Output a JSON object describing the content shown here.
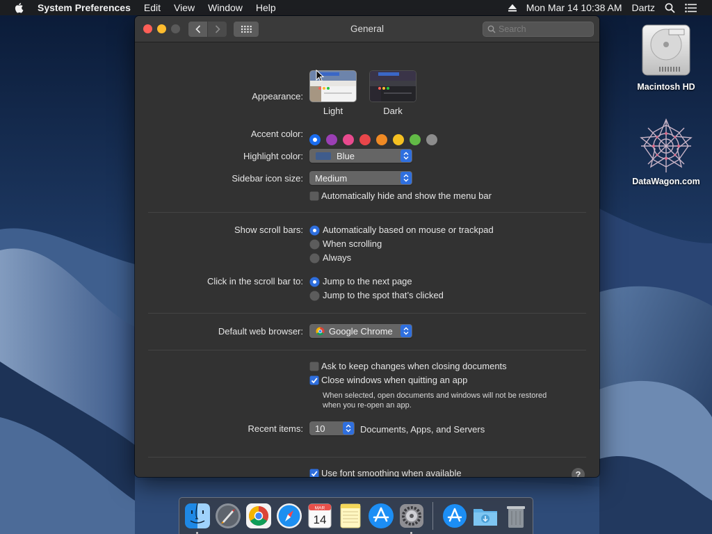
{
  "menubar": {
    "app_name": "System Preferences",
    "menus": [
      "Edit",
      "View",
      "Window",
      "Help"
    ],
    "datetime": "Mon Mar 14  10:38 AM",
    "user": "Dartz"
  },
  "desktop": {
    "icons": [
      {
        "label": "Macintosh HD"
      },
      {
        "label": "DataWagon.com"
      }
    ]
  },
  "window": {
    "title": "General",
    "search_placeholder": "Search"
  },
  "appearance": {
    "label": "Appearance:",
    "options": [
      {
        "label": "Light",
        "selected": true
      },
      {
        "label": "Dark",
        "selected": false
      }
    ]
  },
  "accent": {
    "label": "Accent color:",
    "colors": [
      "#1a6df0",
      "#9b3fb5",
      "#e84a8e",
      "#e8464a",
      "#f08a24",
      "#f5c021",
      "#62ba46",
      "#8c8c8c"
    ],
    "selected_index": 0
  },
  "highlight": {
    "label": "Highlight color:",
    "value": "Blue",
    "chip_color": "#3f5c8c"
  },
  "sidebar_icon_size": {
    "label": "Sidebar icon size:",
    "value": "Medium"
  },
  "auto_hide_menubar": {
    "label": "Automatically hide and show the menu bar",
    "checked": false
  },
  "scroll_bars": {
    "label": "Show scroll bars:",
    "options": [
      {
        "label": "Automatically based on mouse or trackpad",
        "selected": true
      },
      {
        "label": "When scrolling",
        "selected": false
      },
      {
        "label": "Always",
        "selected": false
      }
    ]
  },
  "scroll_click": {
    "label": "Click in the scroll bar to:",
    "options": [
      {
        "label": "Jump to the next page",
        "selected": true
      },
      {
        "label": "Jump to the spot that’s clicked",
        "selected": false
      }
    ]
  },
  "browser": {
    "label": "Default web browser:",
    "value": "Google Chrome"
  },
  "ask_keep_changes": {
    "label": "Ask to keep changes when closing documents",
    "checked": false
  },
  "close_windows": {
    "label": "Close windows when quitting an app",
    "checked": true,
    "note_line1": "When selected, open documents and windows will not be restored",
    "note_line2": "when you re-open an app."
  },
  "recent_items": {
    "label": "Recent items:",
    "value": "10",
    "suffix": "Documents, Apps, and Servers"
  },
  "font_smoothing": {
    "label": "Use font smoothing when available",
    "checked": true
  },
  "help_label": "?",
  "dock": {
    "items": [
      "finder-icon",
      "launchpad-icon",
      "chrome-icon",
      "safari-icon",
      "calendar-icon",
      "notes-icon",
      "app-store-icon",
      "system-preferences-icon",
      "app-store-download-icon",
      "downloads-folder-icon",
      "trash-icon"
    ],
    "calendar_month": "MAR",
    "calendar_day": "14"
  }
}
